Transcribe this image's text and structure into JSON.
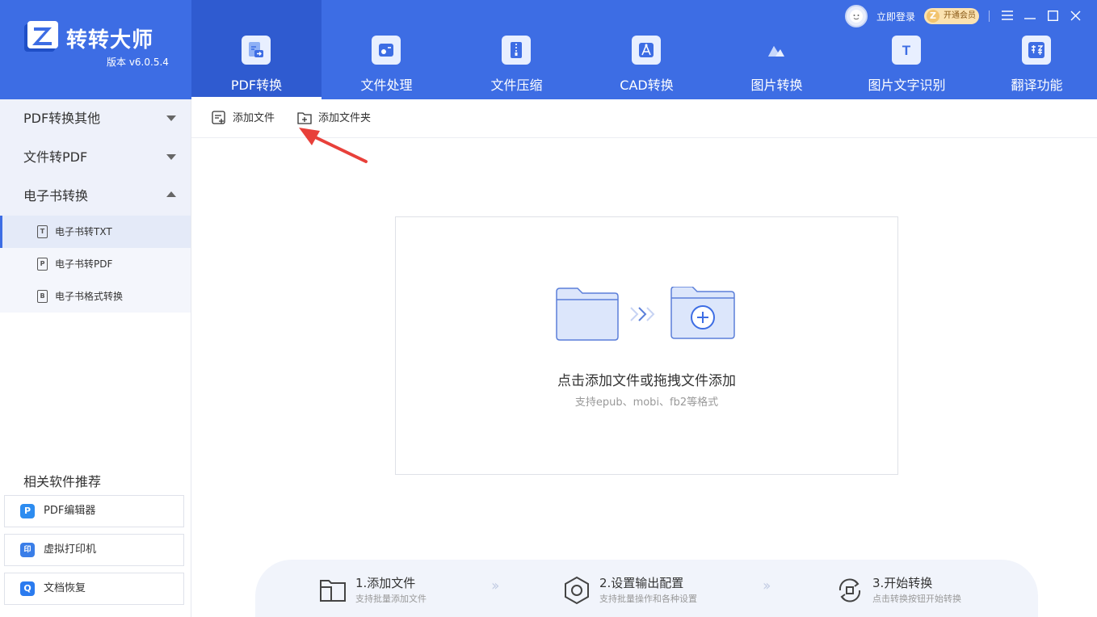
{
  "app": {
    "title": "转转大师",
    "version": "版本 v6.0.5.4"
  },
  "nav": [
    {
      "label": "PDF转换",
      "icon": "pdf-convert-icon",
      "active": true
    },
    {
      "label": "文件处理",
      "icon": "file-process-icon",
      "active": false
    },
    {
      "label": "文件压缩",
      "icon": "file-compress-icon",
      "active": false
    },
    {
      "label": "CAD转换",
      "icon": "cad-convert-icon",
      "active": false
    },
    {
      "label": "图片转换",
      "icon": "image-convert-icon",
      "active": false
    },
    {
      "label": "图片文字识别",
      "icon": "ocr-icon",
      "active": false
    },
    {
      "label": "翻译功能",
      "icon": "translate-icon",
      "active": false
    }
  ],
  "user": {
    "login_label": "立即登录",
    "vip_label": "开通会员"
  },
  "sidebar": {
    "groups": [
      {
        "label": "PDF转换其他",
        "expanded": false
      },
      {
        "label": "文件转PDF",
        "expanded": false
      },
      {
        "label": "电子书转换",
        "expanded": true
      }
    ],
    "items": [
      {
        "label": "电子书转TXT",
        "icon_glyph": "T",
        "active": true
      },
      {
        "label": "电子书转PDF",
        "icon_glyph": "P",
        "active": false
      },
      {
        "label": "电子书格式转换",
        "icon_glyph": "B",
        "active": false
      }
    ],
    "recommend_title": "相关软件推荐",
    "recommend": [
      {
        "label": "PDF编辑器",
        "icon_glyph": "P"
      },
      {
        "label": "虚拟打印机",
        "icon_glyph": "印"
      },
      {
        "label": "文档恢复",
        "icon_glyph": "Q"
      }
    ]
  },
  "toolbar": {
    "add_file": "添加文件",
    "add_folder": "添加文件夹"
  },
  "drop": {
    "title": "点击添加文件或拖拽文件添加",
    "subtitle": "支持epub、mobi、fb2等格式"
  },
  "steps": [
    {
      "title": "1.添加文件",
      "desc": "支持批量添加文件"
    },
    {
      "title": "2.设置输出配置",
      "desc": "支持批量操作和各种设置"
    },
    {
      "title": "3.开始转换",
      "desc": "点击转换按钮开始转换"
    }
  ],
  "colors": {
    "header": "#3d6de4",
    "active_tab": "#2f5bd0",
    "annotation_arrow": "#e8403a"
  }
}
